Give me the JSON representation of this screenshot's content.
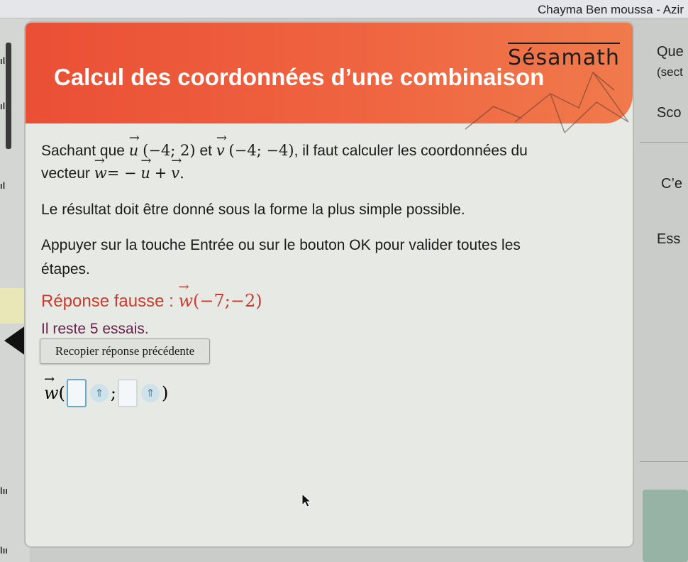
{
  "topbar": {
    "user_name": "Chayma Ben moussa - Azir"
  },
  "banner": {
    "logo": "Sésamath",
    "title": "Calcul des coordonnées d’une combinaison"
  },
  "question": {
    "intro": "Sachant que",
    "u_letter": "u",
    "u_coords": "(−4; 2)",
    "et": "et",
    "v_letter": "v",
    "v_coords": "(−4; −4)",
    "after_v": ", il faut calculer les coordonnées du",
    "vecteur": "vecteur",
    "w_letter": "w",
    "expr_eq_minus": "= −",
    "expr_u": "u",
    "expr_plus": "+",
    "expr_v": "v",
    "expr_end": ".",
    "simple_form": "Le résultat doit être donné sous la forme la plus simple possible.",
    "instruction_line1": "Appuyer sur la touche Entrée ou sur le bouton OK pour valider toutes les",
    "instruction_line2": "étapes."
  },
  "feedback": {
    "wrong_label": "Réponse fausse : ",
    "w_letter": "w",
    "wrong_value": "(−7;−2)",
    "tries_left": "Il reste 5 essais."
  },
  "copy_button": {
    "label": "Recopier réponse précédente"
  },
  "answer": {
    "w_letter": "w",
    "open_paren": "(",
    "separator": ";",
    "close_paren": ")",
    "kbd_icon_symbol": "⇑"
  },
  "right_panel": {
    "que": "Que",
    "sect": "(sect",
    "sco": "Sco",
    "ce": "C’e",
    "ess": "Ess"
  },
  "left_marks": [
    "ıl",
    "ıl",
    "ıl",
    "lıı",
    "lıı"
  ],
  "colors": {
    "banner": "#ef5a3c",
    "wrong": "#c83b2d",
    "tries": "#6b1f4d",
    "input_border": "#6aa8c4"
  },
  "icons": {
    "keyboard": "keyboard-toggle-icon",
    "previous": "previous-arrow-icon",
    "cursor": "mouse-cursor-icon"
  }
}
